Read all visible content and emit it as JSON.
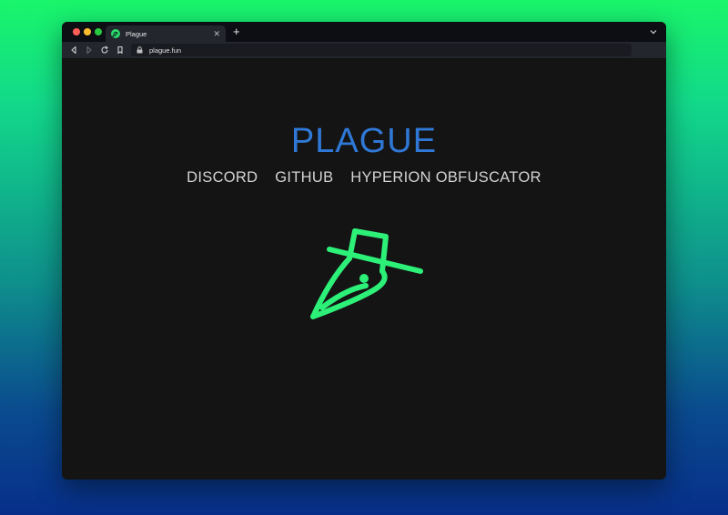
{
  "browser": {
    "tab": {
      "title": "Plague",
      "favicon": "plague-doctor-icon"
    },
    "url": "plague.fun"
  },
  "page": {
    "title": "PLAGUE",
    "nav": [
      "DISCORD",
      "GITHUB",
      "HYPERION OBFUSCATOR"
    ],
    "logo": "plague-doctor-mask-icon"
  },
  "colors": {
    "background_gradient_top": "#19f56a",
    "background_gradient_bottom": "#072f8a",
    "page_background": "#141414",
    "title": "#2f78d6",
    "nav_text": "#d4d4d4",
    "logo": "#2cf078"
  }
}
